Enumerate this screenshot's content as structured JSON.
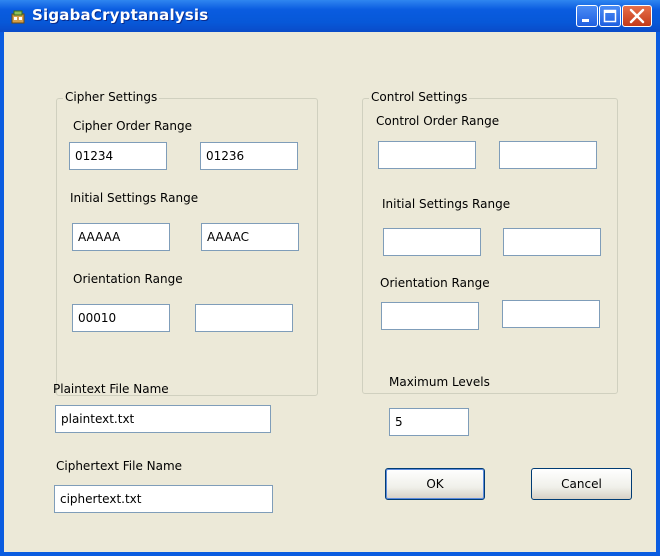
{
  "window": {
    "title": "SigabaCryptanalysis"
  },
  "cipher_settings": {
    "title": "Cipher Settings",
    "order_label": "Cipher Order Range",
    "order_from": "01234",
    "order_to": "01236",
    "initial_label": "Initial Settings Range",
    "initial_from": "AAAAA",
    "initial_to": "AAAAC",
    "orientation_label": "Orientation Range",
    "orientation_from": "00010",
    "orientation_to": ""
  },
  "control_settings": {
    "title": "Control Settings",
    "order_label": "Control Order Range",
    "order_from": "",
    "order_to": "",
    "initial_label": "Initial Settings Range",
    "initial_from": "",
    "initial_to": "",
    "orientation_label": "Orientation Range",
    "orientation_from": "",
    "orientation_to": ""
  },
  "plaintext": {
    "label": "Plaintext File Name",
    "value": "plaintext.txt"
  },
  "ciphertext": {
    "label": "Ciphertext File Name",
    "value": "ciphertext.txt"
  },
  "max_levels": {
    "label": "Maximum Levels",
    "value": "5"
  },
  "buttons": {
    "ok": "OK",
    "cancel": "Cancel"
  },
  "colors": {
    "titlebar": "#0a5ce0",
    "client_bg": "#ece9d8",
    "textbox_border": "#7f9db9",
    "close_button": "#d5542e"
  }
}
